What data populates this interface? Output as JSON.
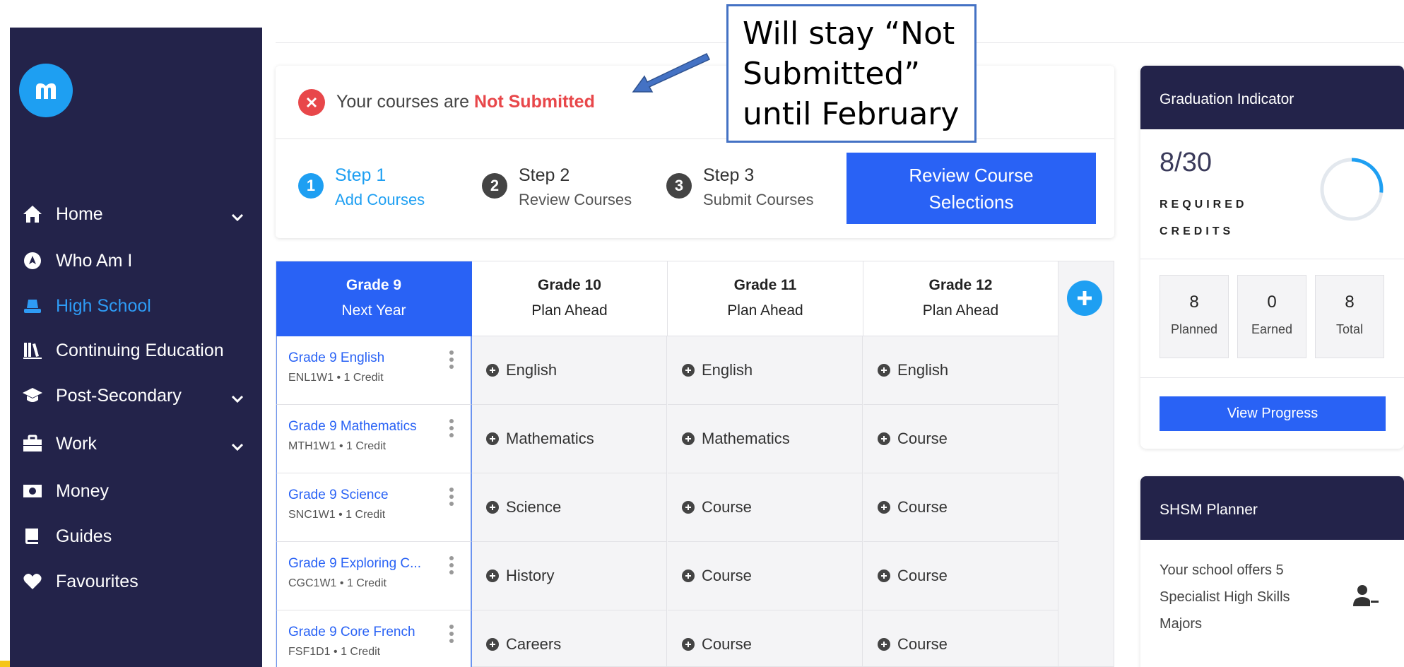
{
  "sidebar": {
    "logo_icon": "m-logo-icon",
    "items": [
      {
        "label": "Home",
        "icon": "home-icon",
        "chevron": true
      },
      {
        "label": "Who Am I",
        "icon": "compass-icon",
        "chevron": false
      },
      {
        "label": "High School",
        "icon": "hat-icon",
        "chevron": false,
        "active": true
      },
      {
        "label": "Continuing Education",
        "icon": "books-icon",
        "chevron": false
      },
      {
        "label": "Post-Secondary",
        "icon": "graduation-cap-icon",
        "chevron": true
      },
      {
        "label": "Work",
        "icon": "briefcase-icon",
        "chevron": true
      },
      {
        "label": "Money",
        "icon": "money-icon",
        "chevron": false
      },
      {
        "label": "Guides",
        "icon": "book-icon",
        "chevron": false
      },
      {
        "label": "Favourites",
        "icon": "heart-icon",
        "chevron": false
      }
    ]
  },
  "status": {
    "prefix": "Your courses are ",
    "state": "Not Submitted"
  },
  "steps": [
    {
      "num": "1",
      "title": "Step 1",
      "sub": "Add Courses",
      "active": true
    },
    {
      "num": "2",
      "title": "Step 2",
      "sub": "Review Courses",
      "active": false
    },
    {
      "num": "3",
      "title": "Step 3",
      "sub": "Submit Courses",
      "active": false
    }
  ],
  "review_button": "Review Course Selections",
  "grid": {
    "columns": [
      {
        "grade": "Grade 9",
        "plan": "Next Year"
      },
      {
        "grade": "Grade 10",
        "plan": "Plan Ahead"
      },
      {
        "grade": "Grade 11",
        "plan": "Plan Ahead"
      },
      {
        "grade": "Grade 12",
        "plan": "Plan Ahead"
      }
    ],
    "courses": [
      {
        "name": "Grade 9 English",
        "code": "ENL1W1 • 1 Credit"
      },
      {
        "name": "Grade 9 Mathematics",
        "code": "MTH1W1 • 1 Credit"
      },
      {
        "name": "Grade 9 Science",
        "code": "SNC1W1 • 1 Credit"
      },
      {
        "name": "Grade 9 Exploring C...",
        "code": "CGC1W1 • 1 Credit"
      },
      {
        "name": "Grade 9 Core French",
        "code": "FSF1D1 • 1 Credit"
      }
    ],
    "slots": [
      [
        "English",
        "English",
        "English"
      ],
      [
        "Mathematics",
        "Mathematics",
        "Course"
      ],
      [
        "Science",
        "Course",
        "Course"
      ],
      [
        "History",
        "Course",
        "Course"
      ],
      [
        "Careers",
        "Course",
        "Course"
      ]
    ]
  },
  "graduation": {
    "title": "Graduation Indicator",
    "credits": "8/30",
    "required_label": "REQUIRED CREDITS",
    "progress_fraction": 0.267,
    "stats": [
      {
        "value": "8",
        "label": "Planned"
      },
      {
        "value": "0",
        "label": "Earned"
      },
      {
        "value": "8",
        "label": "Total"
      }
    ],
    "view_button": "View Progress"
  },
  "shsm": {
    "title": "SHSM Planner",
    "text": "Your school offers 5 Specialist High Skills Majors",
    "icon": "user-minus-icon"
  },
  "annotation": {
    "text": "Will stay “Not Submitted” until February"
  },
  "colors": {
    "sidebar": "#23234a",
    "accent_blue": "#2962f5",
    "light_blue": "#1e9ff2",
    "error_red": "#e8474a"
  }
}
